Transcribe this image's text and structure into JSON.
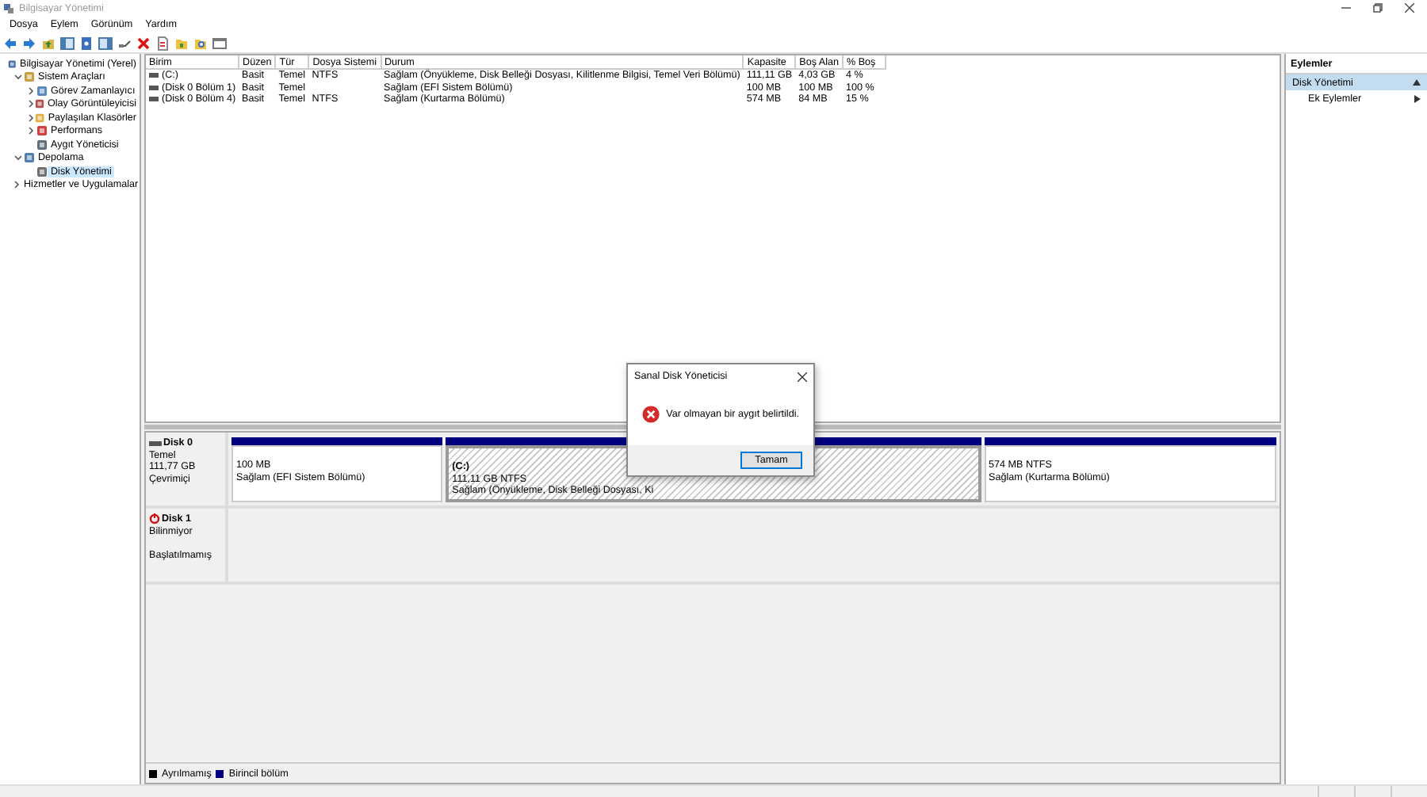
{
  "window": {
    "title": "Bilgisayar Yönetimi"
  },
  "menu": [
    "Dosya",
    "Eylem",
    "Görünüm",
    "Yardım"
  ],
  "tree": [
    {
      "label": "Bilgisayar Yönetimi (Yerel)",
      "selected": false,
      "children": [
        {
          "label": "Sistem Araçları",
          "expanded": true,
          "selected": false,
          "children": [
            {
              "label": "Görev Zamanlayıcı",
              "expanded": false,
              "selected": false
            },
            {
              "label": "Olay Görüntüleyicisi",
              "expanded": false,
              "selected": false
            },
            {
              "label": "Paylaşılan Klasörler",
              "expanded": false,
              "selected": false
            },
            {
              "label": "Performans",
              "expanded": false,
              "selected": false
            },
            {
              "label": "Aygıt Yöneticisi",
              "selected": false
            }
          ]
        },
        {
          "label": "Depolama",
          "expanded": true,
          "selected": false,
          "children": [
            {
              "label": "Disk Yönetimi",
              "selected": true
            }
          ]
        },
        {
          "label": "Hizmetler ve Uygulamalar",
          "expanded": false,
          "selected": false
        }
      ]
    }
  ],
  "volumes": {
    "columns": [
      "Birim",
      "Düzen",
      "Tür",
      "Dosya Sistemi",
      "Durum",
      "Kapasite",
      "Boş Alan",
      "% Boş"
    ],
    "rows": [
      [
        "(C:)",
        "Basit",
        "Temel",
        "NTFS",
        "Sağlam (Önyükleme, Disk Belleği Dosyası, Kilitlenme Bilgisi, Temel Veri Bölümü)",
        "111,11 GB",
        "4,03 GB",
        "4 %"
      ],
      [
        "(Disk 0 Bölüm 1)",
        "Basit",
        "Temel",
        "",
        "Sağlam (EFI Sistem Bölümü)",
        "100 MB",
        "100 MB",
        "100 %"
      ],
      [
        "(Disk 0 Bölüm 4)",
        "Basit",
        "Temel",
        "NTFS",
        "Sağlam (Kurtarma Bölümü)",
        "574 MB",
        "84 MB",
        "15 %"
      ]
    ]
  },
  "disks": [
    {
      "name": "Disk 0",
      "kind": "online",
      "lines": [
        "Temel",
        "111,77 GB",
        "Çevrimiçi"
      ],
      "partitions": [
        {
          "size": "100 MB",
          "status": "Sağlam (EFI Sistem Bölümü)",
          "selected": false
        },
        {
          "label": "(C:)",
          "size": "111,11 GB NTFS",
          "status": "Sağlam (Önyükleme, Disk Belleği Dosyası, Ki",
          "selected": true
        },
        {
          "size": "574 MB NTFS",
          "status": "Sağlam (Kurtarma Bölümü)",
          "selected": false
        }
      ]
    },
    {
      "name": "Disk 1",
      "kind": "unknown",
      "lines": [
        "Bilinmiyor",
        "Başlatılmamış"
      ]
    }
  ],
  "legend": [
    {
      "label": "Ayrılmamış",
      "color": "#000000"
    },
    {
      "label": "Birincil bölüm",
      "color": "#00007f"
    }
  ],
  "actions": {
    "title": "Eylemler",
    "items": [
      {
        "label": "Disk Yönetimi",
        "kind": "header",
        "selected": true
      },
      {
        "label": "Ek Eylemler",
        "kind": "submenu",
        "selected": false
      }
    ]
  },
  "dialog": {
    "title": "Sanal Disk Yöneticisi",
    "message": "Var olmayan bir aygıt belirtildi.",
    "button": "Tamam"
  }
}
